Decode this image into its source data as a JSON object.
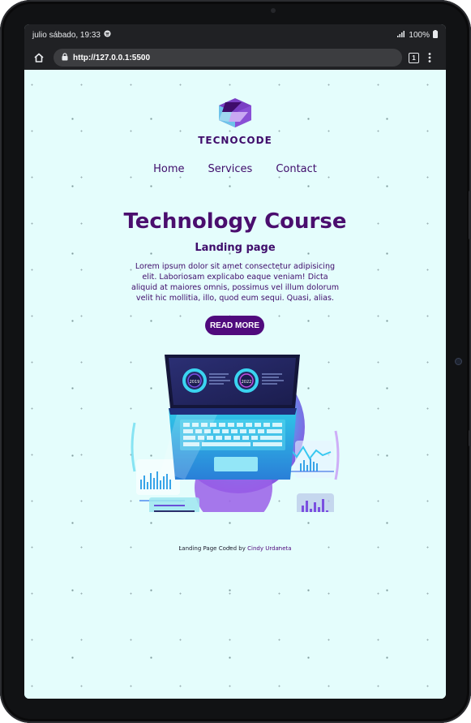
{
  "status_bar": {
    "datetime": "julio sábado, 19:33",
    "battery": "100%"
  },
  "browser": {
    "url": "http://127.0.0.1:5500",
    "tab_count": "1"
  },
  "page": {
    "brand": "TECNOCODE",
    "nav": [
      "Home",
      "Services",
      "Contact"
    ],
    "hero_title": "Technology Course",
    "hero_subtitle": "Landing page",
    "hero_text": "Lorem ipsum dolor sit amet consectetur adipisicing elit. Laboriosam explicabo eaque veniam! Dicta aliquid at maiores omnis, possimus vel illum dolorum velit hic mollitia, illo, quod eum sequi. Quasi, alias.",
    "read_more": "READ MORE",
    "illustration_years": [
      "2019",
      "2022"
    ],
    "footer_prefix": "Landing Page Coded by",
    "footer_author": "Cindy Urdaneta"
  },
  "colors": {
    "page_bg": "#e4fdfc",
    "brand_purple": "#4a0e6e",
    "button_bg": "#500a7d",
    "browser_chrome": "#202124"
  }
}
